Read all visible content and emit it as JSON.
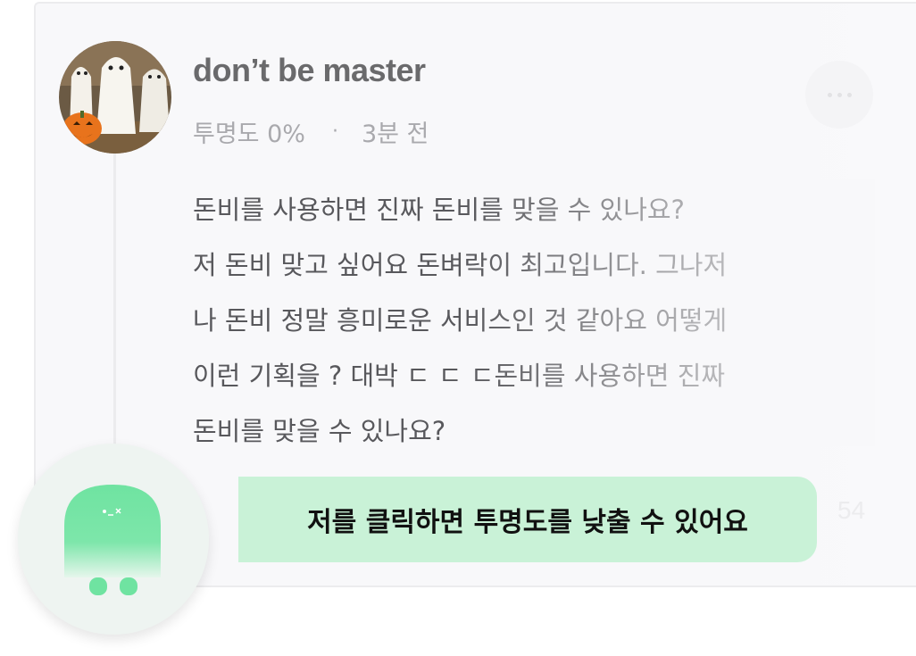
{
  "comment": {
    "username": "don’t be master",
    "opacity_label": "투명도 0%",
    "separator": "·",
    "time": "3분 전",
    "body_lines": [
      "돈비를 사용하면 진짜 돈비를 맞을 수 있나요?",
      "저 돈비 맞고 싶어요 돈벼락이 최고입니다. 그나저",
      "나 돈비 정말 흥미로운 서비스인 것 같아요 어떻게",
      "이런 기획을 ? 대박 ㄷ ㄷ ㄷ돈비를 사용하면 진짜",
      "돈비를 맞을 수 있나요?"
    ],
    "like_count": "54"
  },
  "tooltip": {
    "text": "저를 클릭하면 투명도를 낮출 수 있어요"
  },
  "icons": {
    "avatar": "profile-photo-ghost-dogs",
    "more": "more-dots-icon",
    "ghost": "ghost-icon"
  },
  "colors": {
    "accent_green": "#6fe3a1",
    "tooltip_bg": "#c9f2d7",
    "card_bg": "#f8f8fa"
  }
}
